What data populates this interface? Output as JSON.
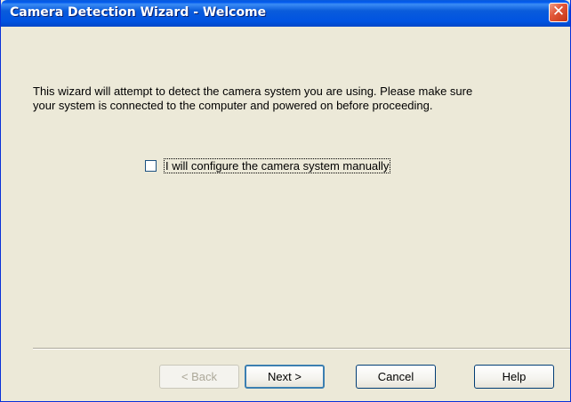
{
  "window": {
    "title": "Camera Detection Wizard - Welcome",
    "close_glyph": "✕"
  },
  "content": {
    "description_line1": "This wizard will attempt to detect the camera system you are using.  Please make sure",
    "description_line2": "your system is connected to the computer and powered on before proceeding.",
    "manual_checkbox": {
      "label": "I will configure the camera system manually",
      "checked": false
    }
  },
  "buttons": {
    "back": "< Back",
    "next": "Next >",
    "cancel": "Cancel",
    "help": "Help"
  },
  "colors": {
    "titlebar": "#0A5CDB",
    "dialog_background": "#ECE9D8",
    "close_button": "#E2583A"
  },
  "icons": {
    "close": "close-icon"
  }
}
